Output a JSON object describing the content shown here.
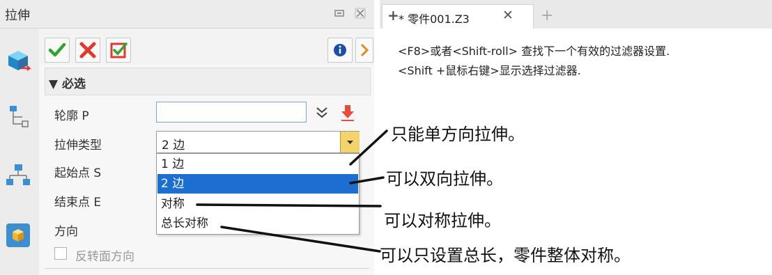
{
  "panel": {
    "title": "拉伸",
    "pin_icon": "pin-icon",
    "close_icon": "close-icon"
  },
  "toolbar": {
    "ok_icon": "checkmark-icon",
    "cancel_icon": "x-icon",
    "apply_icon": "apply-icon",
    "info_icon": "info-icon",
    "expand_icon": "expand-icon"
  },
  "section": {
    "title": "▼ 必选"
  },
  "fields": {
    "profile_label": "轮廓 P",
    "profile_value": "",
    "type_label": "拉伸类型",
    "type_value": "2 边",
    "start_label": "起始点 S",
    "end_label": "结束点 E",
    "direction_label": "方向",
    "reverse_label": "反转面方向"
  },
  "dropdown": {
    "options": [
      "1 边",
      "2 边",
      "对称",
      "总长对称"
    ],
    "selected_index": 1
  },
  "tabs": {
    "doc_tab": "* 零件001.Z3",
    "new_tab": "+"
  },
  "hints": {
    "line1": "<F8>或者<Shift-roll> 查找下一个有效的过滤器设置.",
    "line2": "<Shift +鼠标右键>显示选择过滤器."
  },
  "annotations": {
    "a1": "只能单方向拉伸。",
    "a2": "可以双向拉伸。",
    "a3": "可以对称拉伸。",
    "a4": "可以只设置总长，零件整体对称。"
  },
  "colors": {
    "accent": "#1c6fd1",
    "ok_green": "#2fa52f",
    "cancel_red": "#e03a2f"
  }
}
